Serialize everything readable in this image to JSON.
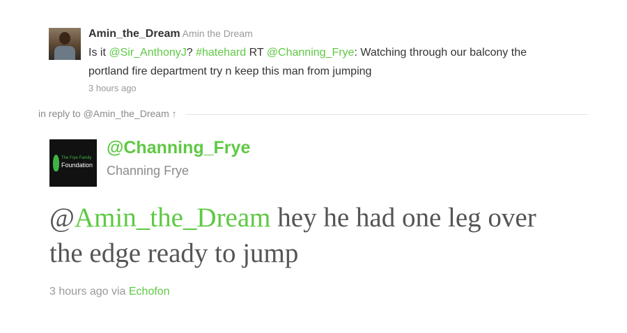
{
  "parent": {
    "username": "Amin_the_Dream",
    "realname": "Amin the Dream",
    "text": {
      "t1": "Is it ",
      "m1": "@Sir_AnthonyJ",
      "t2": "? ",
      "h1": "#hatehard",
      "t3": " RT ",
      "m2": "@Channing_Frye",
      "t4": ": Watching through our balcony the portland fire department try n keep this man from jumping"
    },
    "time": "3 hours ago"
  },
  "in_reply": "in reply to @Amin_the_Dream ↑",
  "main": {
    "avatar": {
      "line1": "The Frye Family",
      "line2": "Foundation"
    },
    "screen_name": "@Channing_Frye",
    "full_name": "Channing Frye",
    "text": {
      "at": "@",
      "mention": "Amin_the_Dream",
      "rest": " hey he had one leg over the edge ready to jump"
    },
    "meta": {
      "time": "3 hours ago",
      "via_label": "via",
      "via_app": "Echofon"
    }
  },
  "colors": {
    "link": "#5ec943",
    "muted": "#999999",
    "text": "#333333"
  }
}
